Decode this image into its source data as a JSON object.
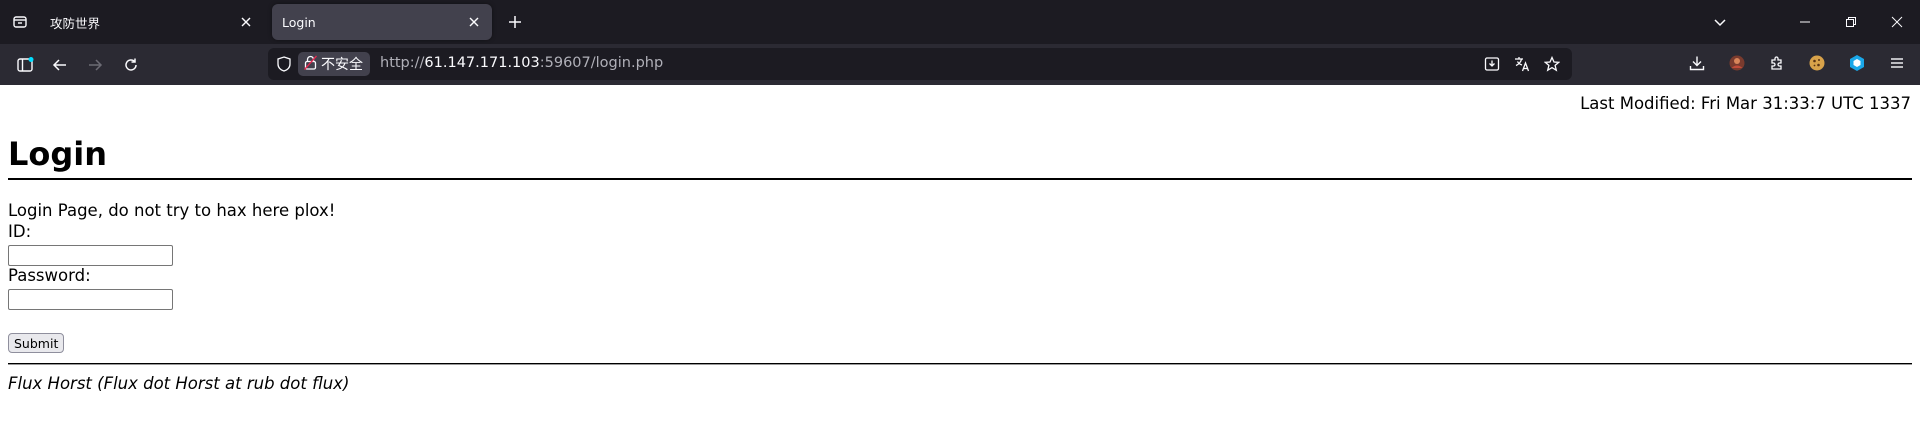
{
  "tabs": [
    {
      "title": "攻防世界",
      "active": false
    },
    {
      "title": "Login",
      "active": true
    }
  ],
  "urlbar": {
    "security_label": "不安全",
    "url_prefix": "http://",
    "url_host": "61.147.171.103",
    "url_suffix": ":59607/login.php"
  },
  "page": {
    "last_modified": "Last Modified: Fri Mar 31:33:7 UTC 1337",
    "title": "Login",
    "intro": "Login Page, do not try to hax here plox!",
    "id_label": "ID:",
    "id_value": "",
    "password_label": "Password:",
    "password_value": "",
    "submit_label": "Submit",
    "footer": "Flux Horst (Flux dot Horst at rub dot flux)"
  },
  "colors": {
    "chrome_bg": "#1c1b22",
    "toolbar_bg": "#2b2a33",
    "active_tab_bg": "#42414d",
    "page_bg": "#ffffff",
    "text": "#000000"
  },
  "icons": {
    "tab_list": "tab-list-icon",
    "close": "close-icon",
    "new_tab": "plus-icon",
    "chevron": "chevron-down-icon",
    "minimize": "minimize-icon",
    "restore": "restore-icon",
    "sidebar": "sidebar-icon",
    "back": "back-arrow-icon",
    "forward": "forward-arrow-icon",
    "reload": "reload-icon",
    "shield": "shield-icon",
    "lock": "insecure-lock-icon",
    "install": "install-icon",
    "translate": "translate-icon",
    "bookmark": "star-icon",
    "downloads": "download-icon",
    "extensions": "puzzle-icon",
    "menu": "hamburger-menu-icon"
  }
}
